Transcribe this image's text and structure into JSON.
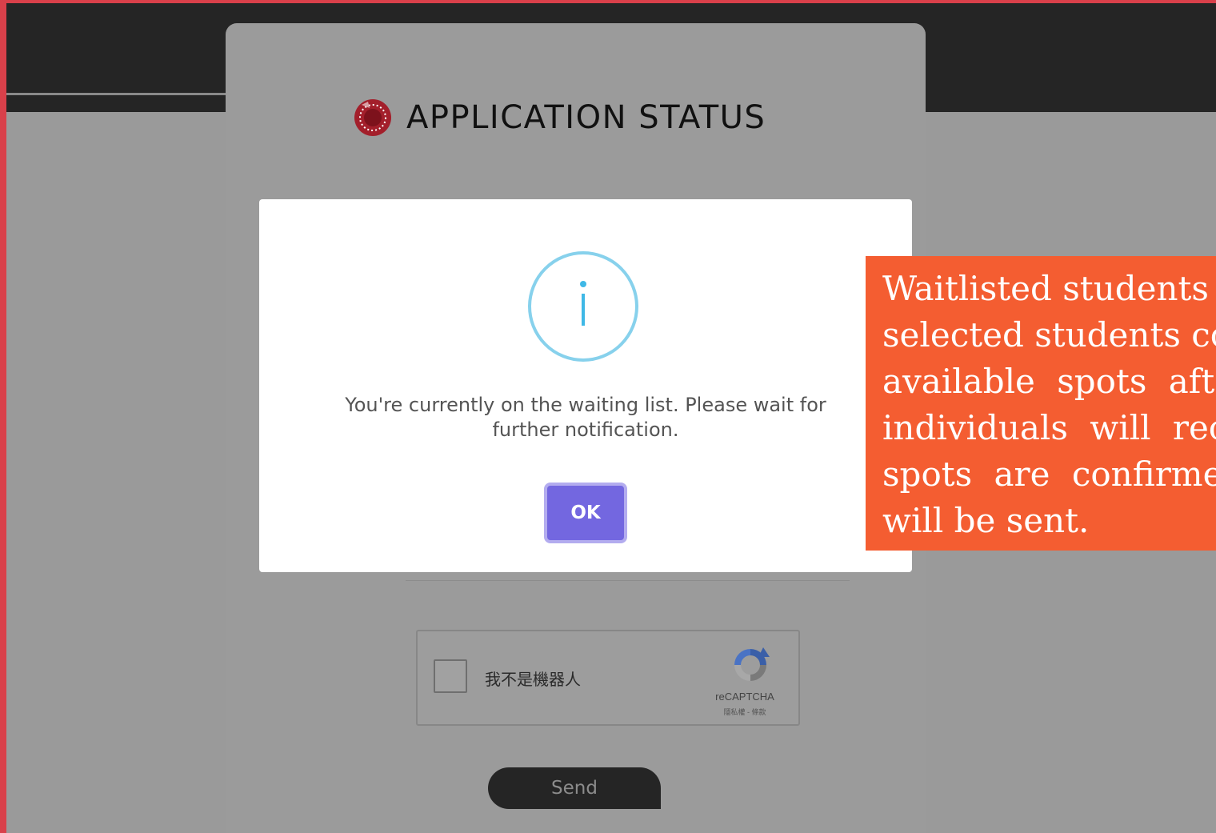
{
  "page": {
    "title": "APPLICATION STATUS",
    "logo_icon": "seal-logo-icon",
    "colors": {
      "frame_border": "#d9404a",
      "topbar": "#252525",
      "overlay": "#9a9a9a",
      "logo": "#a31f2b"
    }
  },
  "modal": {
    "icon": "info-icon",
    "icon_color": "#87d1ec",
    "message": "You're currently on the waiting list. Please wait for further notification.",
    "ok_label": "OK",
    "ok_color": "#7367e0"
  },
  "recaptcha": {
    "checkbox_label": "我不是機器人",
    "brand": "reCAPTCHA",
    "links": "隱私權 - 條款"
  },
  "form": {
    "send_label": "Send"
  },
  "callout": {
    "color": "#f45d31",
    "lines": [
      "Waitlisted students",
      "selected students co",
      "available spots after",
      "individuals will rec",
      "spots are confirmed",
      "will be sent."
    ]
  }
}
